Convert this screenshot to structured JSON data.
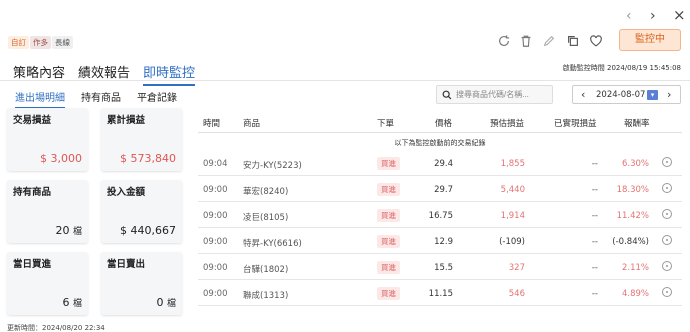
{
  "nav": {
    "prev": "‹",
    "next": "›",
    "close": "×"
  },
  "tags": [
    "自訂",
    "作多",
    "長線"
  ],
  "toolbar": {
    "monitor_button": "監控中"
  },
  "main_tabs": [
    "策略內容",
    "績效報告",
    "即時監控"
  ],
  "start_time": "啟動監控時間 2024/08/19 15:45:08",
  "sub_tabs": [
    "進出場明細",
    "持有商品",
    "平倉記錄"
  ],
  "search": {
    "placeholder": "搜尋商品代碼/名稱..."
  },
  "date_picker": {
    "value": "2024-08-07"
  },
  "cards": [
    {
      "label": "交易損益",
      "value": "$ 3,000",
      "color": "#e25656"
    },
    {
      "label": "累計損益",
      "value": "$ 573,840",
      "color": "#e25656"
    },
    {
      "label": "持有商品",
      "value": "20",
      "unit": "檔"
    },
    {
      "label": "投入金額",
      "value": "$ 440,667"
    },
    {
      "label": "當日買進",
      "value": "6",
      "unit": "檔"
    },
    {
      "label": "當日賣出",
      "value": "0",
      "unit": "檔"
    }
  ],
  "table": {
    "headers": [
      "時間",
      "商品",
      "下單",
      "價格",
      "預估損益",
      "已實現損益",
      "報酬率"
    ],
    "notice": "以下為監控啟動前的交易紀錄",
    "rows": [
      {
        "time": "09:04",
        "product": "安力-KY(5223)",
        "order": "買進",
        "price": "29.4",
        "est_pnl": "1,855",
        "realized": "--",
        "rate": "6.30%",
        "positive": true
      },
      {
        "time": "09:00",
        "product": "華宏(8240)",
        "order": "買進",
        "price": "29.7",
        "est_pnl": "5,440",
        "realized": "--",
        "rate": "18.30%",
        "positive": true
      },
      {
        "time": "09:00",
        "product": "凌巨(8105)",
        "order": "買進",
        "price": "16.75",
        "est_pnl": "1,914",
        "realized": "--",
        "rate": "11.42%",
        "positive": true
      },
      {
        "time": "09:00",
        "product": "特昇-KY(6616)",
        "order": "買進",
        "price": "12.9",
        "est_pnl": "(-109)",
        "realized": "--",
        "rate": "(-0.84%)",
        "positive": false
      },
      {
        "time": "09:00",
        "product": "台驊(1802)",
        "order": "買進",
        "price": "15.5",
        "est_pnl": "327",
        "realized": "--",
        "rate": "2.11%",
        "positive": true
      },
      {
        "time": "09:00",
        "product": "聯成(1313)",
        "order": "買進",
        "price": "11.15",
        "est_pnl": "546",
        "realized": "--",
        "rate": "4.89%",
        "positive": true
      }
    ]
  },
  "update_time": "更新時間：2024/08/20 22:34",
  "colors": {
    "accent": "#2f6fc4",
    "profit": "#e25656",
    "monitor": "#d9621b"
  }
}
